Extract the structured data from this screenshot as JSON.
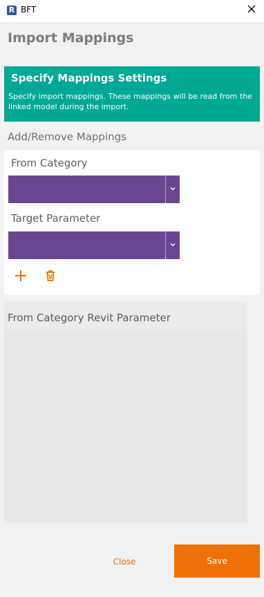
{
  "window": {
    "app_icon_letter": "R",
    "title": "BFT",
    "close_icon": "close-icon"
  },
  "page": {
    "title": "Import Mappings"
  },
  "banner": {
    "title": "Specify Mappings Settings",
    "description": "Specify import mappings. These mappings will be read from the linked model during the import.",
    "color": "#00a896"
  },
  "mappings": {
    "section_label": "Add/Remove Mappings",
    "from_category": {
      "label": "From Category",
      "value": ""
    },
    "target_parameter": {
      "label": "Target Parameter",
      "value": ""
    },
    "add_icon": "plus-icon",
    "delete_icon": "trash-icon",
    "dropdown_color": "#6b4690",
    "action_color": "#e46c0a"
  },
  "grid": {
    "columns": [
      "From Category Revit Parameter"
    ],
    "rows": []
  },
  "footer": {
    "close_label": "Close",
    "save_label": "Save",
    "accent": "#f07109"
  }
}
